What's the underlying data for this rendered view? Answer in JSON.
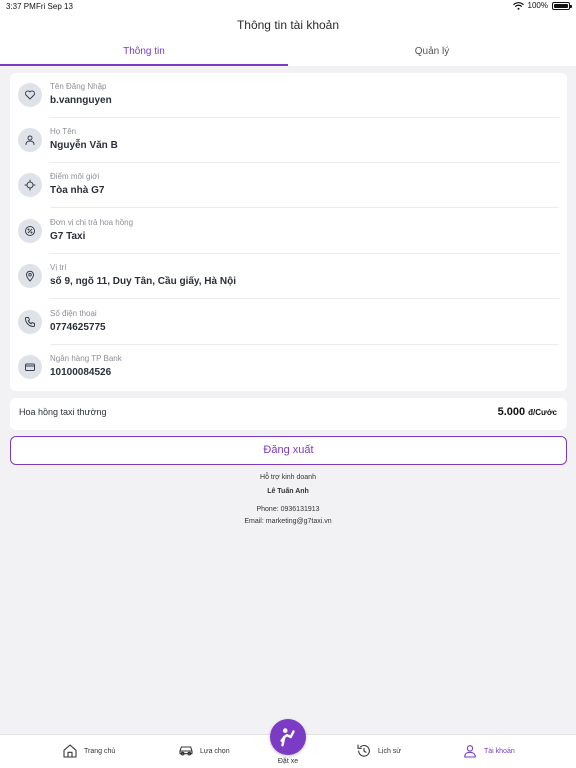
{
  "status_bar": {
    "time": "3:37 PM",
    "date": "Fri Sep 13",
    "battery": "100%",
    "battery_level": 1.0
  },
  "header": {
    "title": "Thông tin tài khoản"
  },
  "tabs": [
    {
      "label": "Thông tin",
      "active": true
    },
    {
      "label": "Quản lý",
      "active": false
    }
  ],
  "info": [
    {
      "icon": "heart-icon",
      "label": "Tên Đăng Nhập",
      "value": "b.vannguyen"
    },
    {
      "icon": "user-icon",
      "label": "Họ Tên",
      "value": "Nguyễn Văn B"
    },
    {
      "icon": "target-icon",
      "label": "Điểm môi giới",
      "value": "Tòa nhà G7"
    },
    {
      "icon": "percent-icon",
      "label": "Đơn vị chi trả hoa hồng",
      "value": "G7 Taxi"
    },
    {
      "icon": "location-pin-icon",
      "label": "Vị trí",
      "value": "số 9, ngõ 11, Duy Tân, Cầu giấy, Hà Nội"
    },
    {
      "icon": "phone-icon",
      "label": "Số điện thoại",
      "value": "0774625775"
    },
    {
      "icon": "credit-card-icon",
      "label": "Ngân hàng TP Bank",
      "value": "10100084526"
    }
  ],
  "commission": {
    "label": "Hoa hồng taxi thường",
    "amount": "5.000",
    "unit": "đ/Cước"
  },
  "logout": {
    "label": "Đăng xuất"
  },
  "support": {
    "title": "Hỗ trợ kinh doanh",
    "name": "Lê Tuấn Anh",
    "phone": "Phone: 0936131913",
    "email": "Email: marketing@g7taxi.vn"
  },
  "bottom_nav": {
    "home": "Trang chủ",
    "options": "Lựa chọn",
    "book": "Đặt xe",
    "history": "Lịch sử",
    "account": "Tài khoản"
  },
  "colors": {
    "accent": "#7b3bc4",
    "background": "#f2f2f4"
  }
}
